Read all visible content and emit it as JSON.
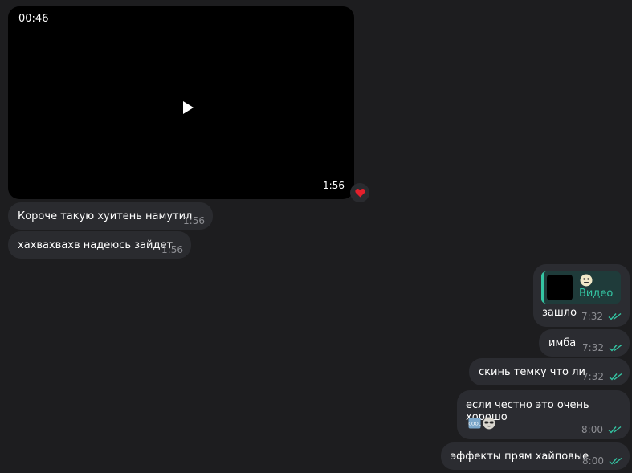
{
  "incoming": {
    "video": {
      "duration": "00:46",
      "time": "1:56",
      "reaction": "heart-icon"
    },
    "messages": [
      {
        "text": "Короче такую хуитень намутил",
        "time": "1:56"
      },
      {
        "text": "хахвахвахв надеюсь зайдет",
        "time": "1:56"
      }
    ]
  },
  "outgoing": {
    "reply": {
      "quote_label": "Видео",
      "text": "зашло",
      "time": "7:32"
    },
    "messages": [
      {
        "text": "имба",
        "time": "7:32"
      },
      {
        "text": "скинь темку что ли",
        "time": "7:32"
      }
    ],
    "long_message": {
      "text": "если честно это очень хорошо",
      "stickers": [
        "cool-icon",
        "sunglasses-face-icon"
      ],
      "time": "8:00"
    },
    "last_message": {
      "text": "эффекты прям хайповые",
      "time": "8:00"
    }
  },
  "colors": {
    "background": "#1d1d1f",
    "bubble": "#2b2c31",
    "accent": "#34c5a3",
    "meta": "#8d8e93"
  }
}
